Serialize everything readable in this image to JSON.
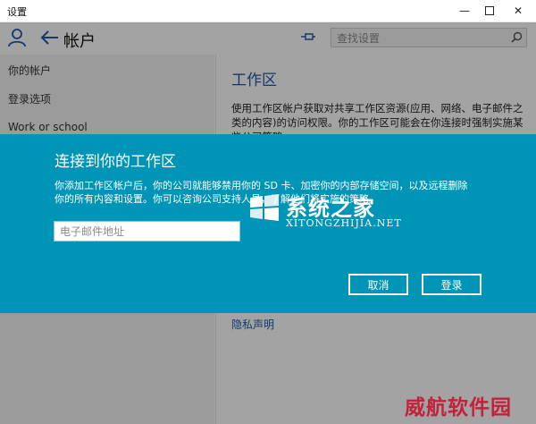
{
  "window": {
    "title": "设置",
    "controls": {
      "minimize": "—",
      "close": "✕"
    }
  },
  "header": {
    "title": "帐户",
    "search": {
      "placeholder": "查找设置",
      "value": ""
    },
    "icons": [
      "person-icon",
      "back-arrow-icon",
      "pin-icon",
      "search-icon"
    ]
  },
  "sidebar": {
    "items": [
      {
        "label": "你的帐户"
      },
      {
        "label": "登录选项"
      },
      {
        "label": "Work or school"
      }
    ]
  },
  "content": {
    "heading": "工作区",
    "description": "使用工作区帐户获取对共享工作区资源(应用、网络、电子邮件之类的内容)的访问权限。你的工作区可能会在你连接时强制实施某些公司策略。",
    "privacy_link": "隐私声明"
  },
  "dialog": {
    "title": "连接到你的工作区",
    "text": "你添加工作区帐户后，你的公司就能够禁用你的 SD 卡、加密你的内部存储空间，以及远程删除你的所有内容和设置。你可以咨询公司支持人员，了解他们将实施的策略。",
    "email": {
      "placeholder": "电子邮件地址",
      "value": ""
    },
    "buttons": {
      "cancel": "取消",
      "sign_in": "登录"
    }
  },
  "watermarks": {
    "center_cn": "系统之家",
    "center_en": "XITONGZHIJIA.NET",
    "corner": "威航软件园"
  },
  "colors": {
    "accent": "#0095b6",
    "heading_blue": "#1a5bb0",
    "watermark_red": "#c4213a"
  }
}
